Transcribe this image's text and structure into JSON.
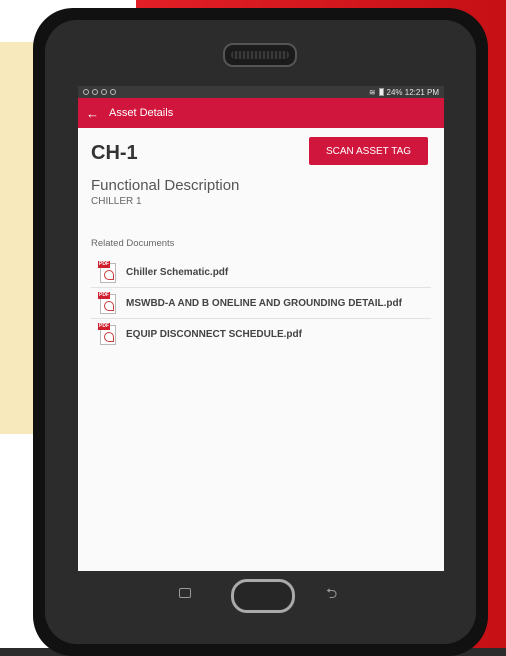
{
  "status_bar": {
    "left_icons": [
      "settings-icon",
      "sync-icon",
      "bluetooth-icon",
      "cast-icon"
    ],
    "right_text": "24% 12:21 PM"
  },
  "app_bar": {
    "back_label": "←",
    "title": "Asset Details"
  },
  "asset": {
    "id": "CH-1",
    "scan_label": "SCAN ASSET TAG"
  },
  "functional": {
    "label": "Functional Description",
    "value": "CHILLER 1"
  },
  "related": {
    "label": "Related Documents",
    "documents": [
      {
        "name": "Chiller Schematic.pdf",
        "icon": "pdf-icon"
      },
      {
        "name": "MSWBD-A AND B ONELINE AND GROUNDING DETAIL.pdf",
        "icon": "pdf-icon"
      },
      {
        "name": "EQUIP DISCONNECT SCHEDULE.pdf",
        "icon": "pdf-icon"
      }
    ]
  },
  "navbar": {
    "recent_icon": "recent-apps-icon",
    "home_icon": "home-button",
    "back_icon": "back-icon",
    "back_glyph": "⮌"
  },
  "colors": {
    "accent": "#d1163d",
    "background_red": "#e21f26",
    "background_yellow": "#f7e9bb"
  }
}
